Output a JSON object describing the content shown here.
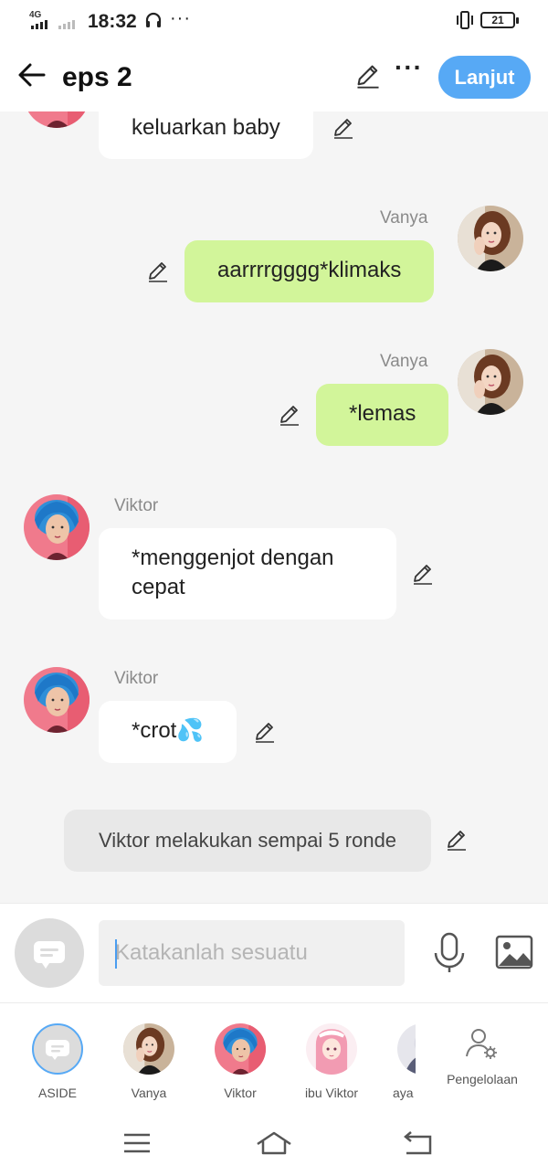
{
  "status_bar": {
    "network": "4G",
    "time": "18:32",
    "more": "···",
    "battery": "21"
  },
  "header": {
    "title": "eps 2",
    "more": "···",
    "continue_label": "Lanjut"
  },
  "messages": [
    {
      "sender": "",
      "text": "keluarkan baby",
      "side": "left"
    },
    {
      "sender": "Vanya",
      "text": "aarrrrgggg*klimaks",
      "side": "right"
    },
    {
      "sender": "Vanya",
      "text": "*lemas",
      "side": "right"
    },
    {
      "sender": "Viktor",
      "text": "*menggenjot dengan cepat",
      "side": "left"
    },
    {
      "sender": "Viktor",
      "text": "*crot💦",
      "side": "left"
    }
  ],
  "narration": "Viktor melakukan sempai 5 ronde",
  "input": {
    "placeholder": "Katakanlah sesuatu",
    "value": ""
  },
  "characters": [
    {
      "label": "ASIDE",
      "selected": true
    },
    {
      "label": "Vanya",
      "selected": false
    },
    {
      "label": "Viktor",
      "selected": false
    },
    {
      "label": "ibu Viktor",
      "selected": false
    },
    {
      "label": "aya",
      "selected": false
    }
  ],
  "manage_label": "Pengelolaan",
  "colors": {
    "accent": "#57a9f5",
    "own_bubble": "#d2f59a",
    "other_bubble": "#ffffff",
    "background": "#f5f5f5"
  },
  "icons": [
    "back-arrow-icon",
    "pencil-icon",
    "more-dots-icon",
    "chat-icon",
    "microphone-icon",
    "image-icon",
    "person-gear-icon",
    "menu-icon",
    "home-icon",
    "back-icon",
    "headphones-icon",
    "vibrate-icon"
  ]
}
